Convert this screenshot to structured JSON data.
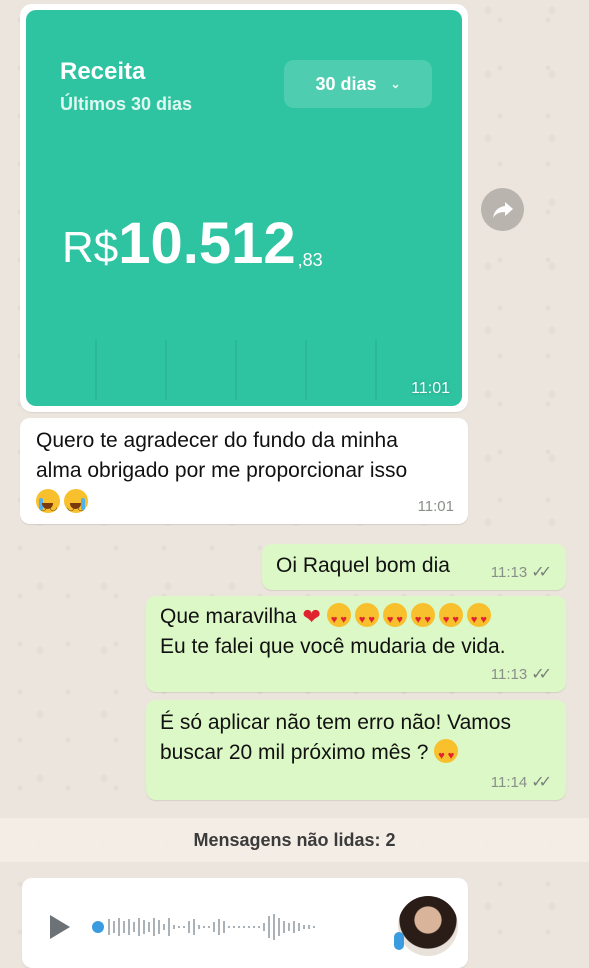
{
  "image_message": {
    "card_title": "Receita",
    "card_subtitle": "Últimos 30 dias",
    "period_selected": "30 dias",
    "amount_currency": "R$",
    "amount_main": "10.512",
    "amount_cents": ",83",
    "time": "11:01",
    "card_color": "#2ec4a2"
  },
  "messages": [
    {
      "direction": "incoming",
      "lines": [
        "Quero te agradecer do fundo da minha",
        "alma obrigado por me proporcionar isso"
      ],
      "emojis": [
        "crying-face",
        "crying-face"
      ],
      "time": "11:01"
    },
    {
      "direction": "outgoing",
      "text": "Oi Raquel bom dia",
      "time": "11:13",
      "status": "read"
    },
    {
      "direction": "outgoing",
      "line1": "Que maravilha",
      "line1_emojis": [
        "red-heart",
        "heart-eyes",
        "heart-eyes",
        "heart-eyes",
        "heart-eyes",
        "heart-eyes",
        "heart-eyes"
      ],
      "line2": "Eu te falei que você mudaria de vida.",
      "time": "11:13",
      "status": "read"
    },
    {
      "direction": "outgoing",
      "line1": "É só aplicar não tem erro não! Vamos",
      "line2": "buscar 20 mil próximo mês ?",
      "line2_emoji": "heart-eyes",
      "time": "11:14",
      "status": "read"
    }
  ],
  "unread_banner": "Mensagens não lidas: 2",
  "audio_message": {
    "icons": [
      "play-icon",
      "waveform",
      "avatar",
      "mic-icon"
    ]
  },
  "colors": {
    "chat_background": "#ece5dd",
    "incoming_bubble": "#ffffff",
    "outgoing_bubble": "#dcf8c6"
  }
}
